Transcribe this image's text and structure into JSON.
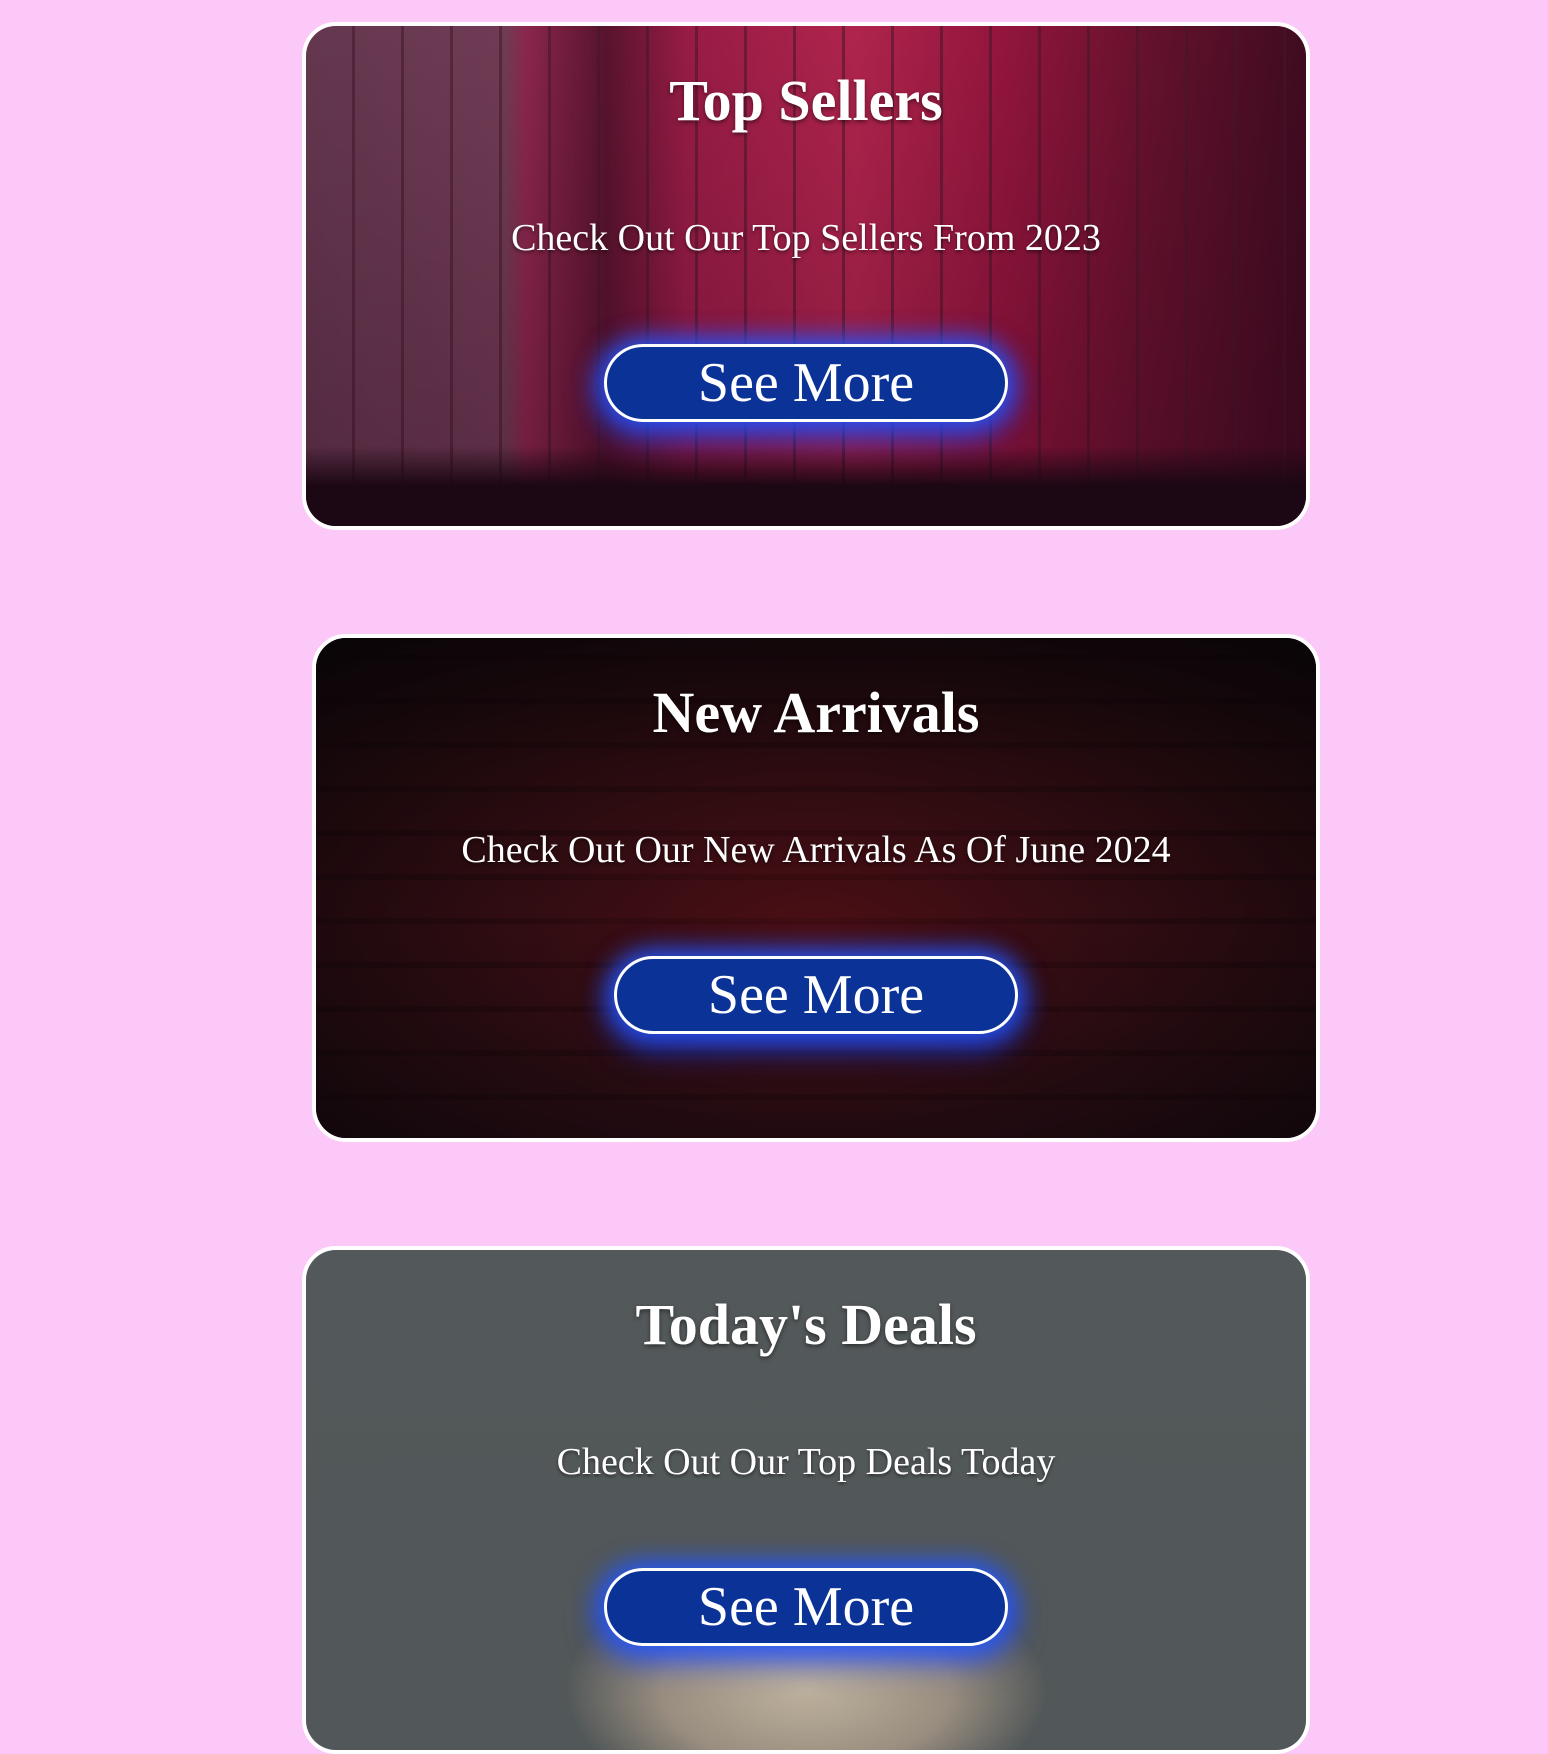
{
  "page": {
    "background_color": "#fbc8f8"
  },
  "cards": [
    {
      "title": "Top Sellers",
      "subtitle": "Check Out Our Top Sellers From 2023",
      "button_label": "See More"
    },
    {
      "title": "New Arrivals",
      "subtitle": "Check Out Our New Arrivals As Of June 2024",
      "button_label": "See More"
    },
    {
      "title": "Today's Deals",
      "subtitle": "Check Out Our Top Deals Today",
      "button_label": "See More"
    }
  ],
  "colors": {
    "button_background": "#0b3296",
    "button_glow": "#235aff",
    "card_border": "#ffffff",
    "text": "#ffffff"
  }
}
